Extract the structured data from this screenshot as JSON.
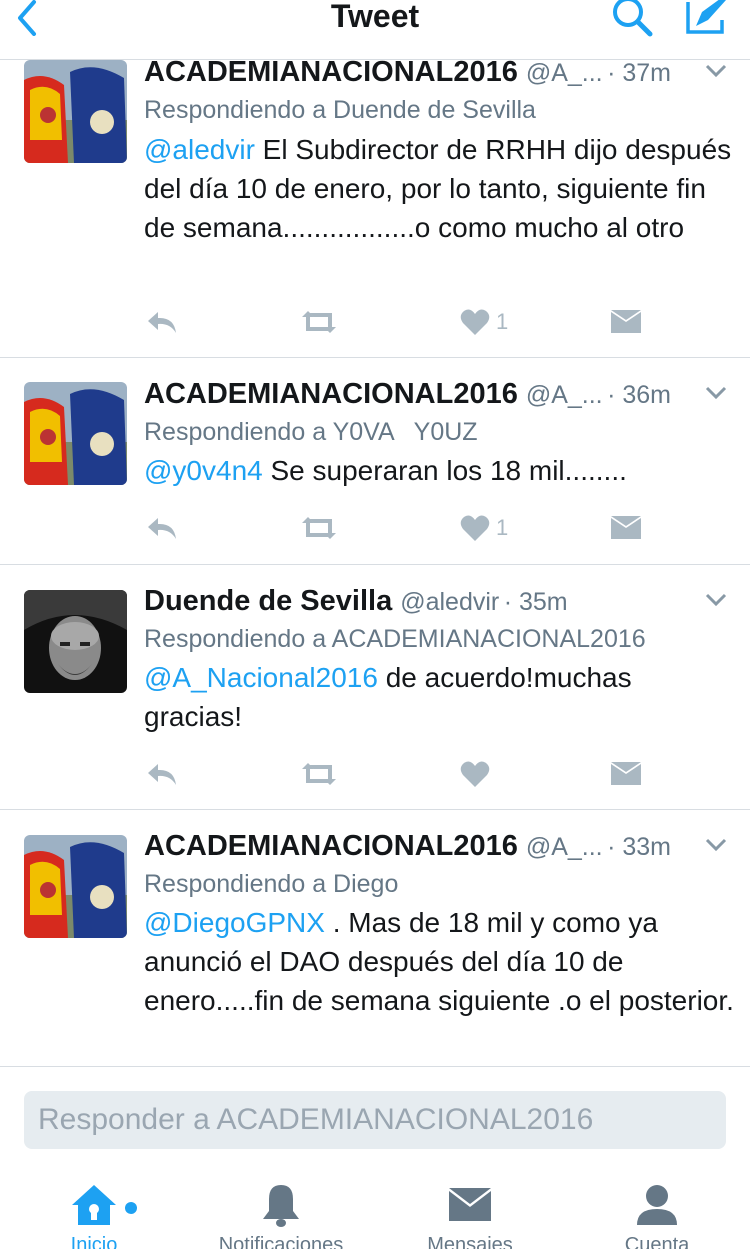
{
  "header": {
    "title": "Tweet",
    "back_icon": "chevron-left-icon",
    "search_icon": "search-icon",
    "compose_icon": "compose-icon",
    "accent": "#1da1f2"
  },
  "tweets": [
    {
      "name": "ACADEMIANACIONAL2016",
      "handle": "@A_...",
      "time": "· 37m",
      "replying": "Respondiendo a Duende de Sevilla",
      "mention": "@aledvir",
      "text": " El Subdirector de RRHH dijo después del día 10 de enero, por lo tanto, siguiente fin de semana.................o como mucho al otro",
      "likes": "1"
    },
    {
      "name": "ACADEMIANACIONAL2016",
      "handle": "@A_...",
      "time": "· 36m",
      "replying": "Respondiendo a Y0VA   Y0UZ",
      "mention": "@y0v4n4",
      "text": " Se superaran los 18 mil........",
      "likes": "1"
    },
    {
      "name": "Duende de Sevilla",
      "handle": "@aledvir",
      "time": "· 35m",
      "replying": "Respondiendo a ACADEMIANACIONAL2016",
      "mention": "@A_Nacional2016",
      "text": " de acuerdo!muchas gracias!",
      "likes": ""
    },
    {
      "name": "ACADEMIANACIONAL2016",
      "handle": "@A_...",
      "time": "· 33m",
      "replying": "Respondiendo a Diego",
      "mention": "@DiegoGPNX",
      "text": " . Mas de 18 mil y como ya anunció el DAO después del día 10 de enero.....fin de semana siguiente .o el posterior.",
      "likes": ""
    }
  ],
  "reply": {
    "placeholder": "Responder a ACADEMIANACIONAL2016"
  },
  "tabs": [
    {
      "label": "Inicio",
      "icon": "home-icon",
      "active": true
    },
    {
      "label": "Notificaciones",
      "icon": "bell-icon",
      "active": false
    },
    {
      "label": "Mensajes",
      "icon": "envelope-icon",
      "active": false
    },
    {
      "label": "Cuenta",
      "icon": "person-icon",
      "active": false
    }
  ]
}
